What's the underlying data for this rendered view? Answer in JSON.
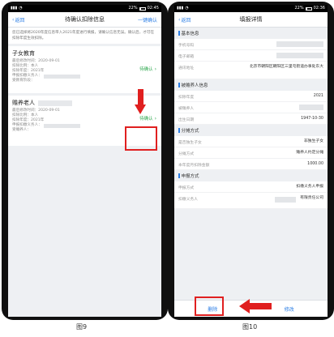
{
  "status_left": {
    "time": "02:45",
    "battery": "22%"
  },
  "status_right": {
    "time": "02:36",
    "battery": "22%"
  },
  "left": {
    "back": "返回",
    "title": "待确认扣除信息",
    "action": "一键确认",
    "notice": "您已选择将2020年度信息带入2021年度进行填报，请确认信息无误。确认后，才可在扣除年度生效扣除。",
    "cards": [
      {
        "name": "子女教育",
        "rows": [
          "最后修改时间：2020-09-01",
          "扣除比例：本人",
          "扣除年度：2021年",
          "申报扣缴义务人：",
          "受教育阶段："
        ],
        "link": "待确认"
      },
      {
        "name": "赡养老人",
        "rows": [
          "最后修改时间：2020-09-01",
          "扣除比例：本人",
          "扣除年度：2021年",
          "申报扣缴义务人：",
          "受赡养人："
        ],
        "link": "待确认"
      }
    ],
    "caption": "图9"
  },
  "right": {
    "back": "返回",
    "title": "填报详情",
    "sections": {
      "basic": "基本信息",
      "dependent": "被赡养人信息",
      "method": "分摊方式",
      "report": "申报方式"
    },
    "basic_rows": [
      {
        "label": "手机号码",
        "value": ""
      },
      {
        "label": "电子邮箱",
        "value": ""
      },
      {
        "label": "通讯地址",
        "value": "北京市朝阳区朝阳区三里屯街道办事处东大"
      }
    ],
    "dependent_rows": [
      {
        "label": "扣除年度",
        "value": "2021"
      },
      {
        "label": "被赡养人",
        "value": ""
      },
      {
        "label": "出生日期",
        "value": "1947-10-30"
      }
    ],
    "method_rows": [
      {
        "label": "是否独生子女",
        "value": "非独生子女"
      },
      {
        "label": "分摊方式",
        "value": "赡养人约定分摊"
      },
      {
        "label": "本年度月扣除金额",
        "value": "1000.00"
      }
    ],
    "report_rows": [
      {
        "label": "申报方式",
        "value": "扣缴义务人申报"
      },
      {
        "label": "扣缴义务人",
        "value": "有限责任公司"
      }
    ],
    "delete_label": "删除",
    "edit_label": "修改",
    "caption": "图10"
  }
}
